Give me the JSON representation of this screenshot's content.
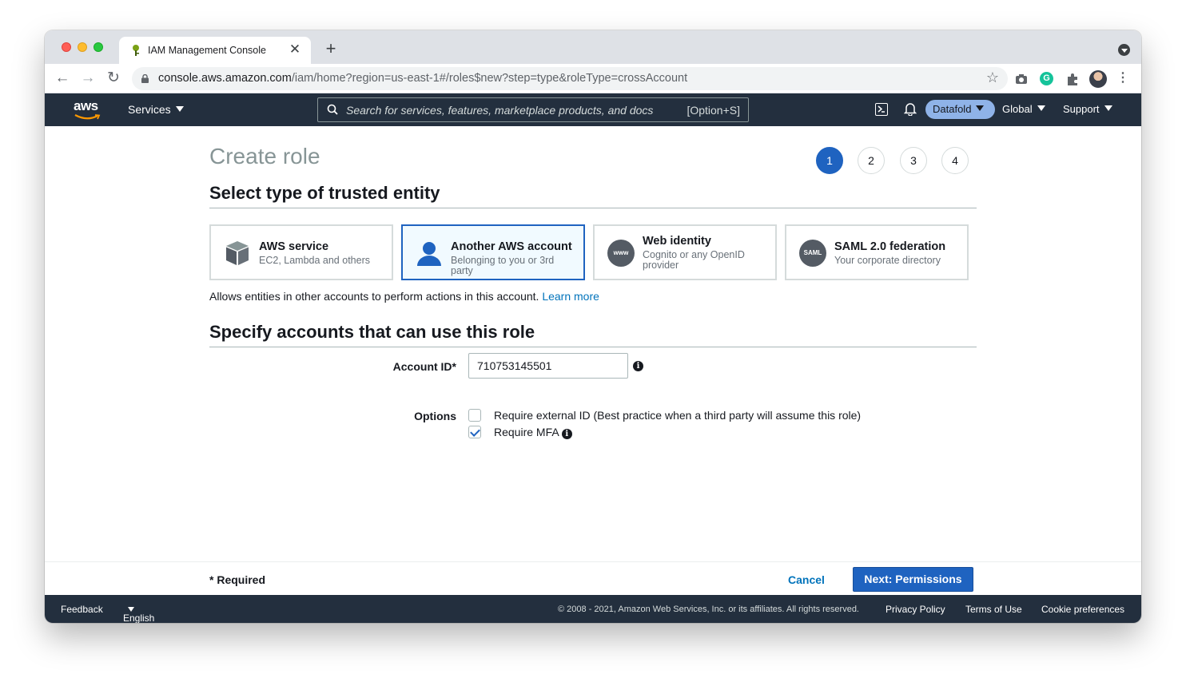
{
  "browser": {
    "tab_title": "IAM Management Console",
    "url_host": "console.aws.amazon.com",
    "url_rest": "/iam/home?region=us-east-1#/roles$new?step=type&roleType=crossAccount"
  },
  "awsnav": {
    "logo": "aws",
    "services": "Services",
    "search_placeholder": "Search for services, features, marketplace products, and docs",
    "search_shortcut": "[Option+S]",
    "account": "Datafold",
    "region": "Global",
    "support": "Support"
  },
  "page": {
    "title": "Create role",
    "steps": [
      "1",
      "2",
      "3",
      "4"
    ],
    "active_step": "1",
    "section1": "Select type of trusted entity",
    "entities": [
      {
        "title": "AWS service",
        "subtitle": "EC2, Lambda and others",
        "icon": "cube-icon"
      },
      {
        "title": "Another AWS account",
        "subtitle": "Belonging to you or 3rd party",
        "icon": "user-icon"
      },
      {
        "title": "Web identity",
        "subtitle": "Cognito or any OpenID provider",
        "icon": "www-icon",
        "icon_text": "www"
      },
      {
        "title": "SAML 2.0 federation",
        "subtitle": "Your corporate directory",
        "icon": "saml-icon",
        "icon_text": "SAML"
      }
    ],
    "selected_entity": "Another AWS account",
    "description": "Allows entities in other accounts to perform actions in this account.",
    "learn_more": "Learn more",
    "section2": "Specify accounts that can use this role",
    "account_id_label": "Account ID*",
    "account_id_value": "710753145501",
    "options_label": "Options",
    "option_external_id": "Require external ID (Best practice when a third party will assume this role)",
    "option_external_id_checked": false,
    "option_mfa": "Require MFA",
    "option_mfa_checked": true
  },
  "actions": {
    "required_note": "* Required",
    "cancel": "Cancel",
    "next": "Next: Permissions"
  },
  "footer": {
    "feedback": "Feedback",
    "language": "English (US)",
    "copyright": "© 2008 - 2021, Amazon Web Services, Inc. or its affiliates. All rights reserved.",
    "privacy": "Privacy Policy",
    "terms": "Terms of Use",
    "cookies": "Cookie preferences"
  },
  "colors": {
    "nav_bg": "#232f3e",
    "primary": "#1f63c0",
    "link": "#0073bb"
  }
}
